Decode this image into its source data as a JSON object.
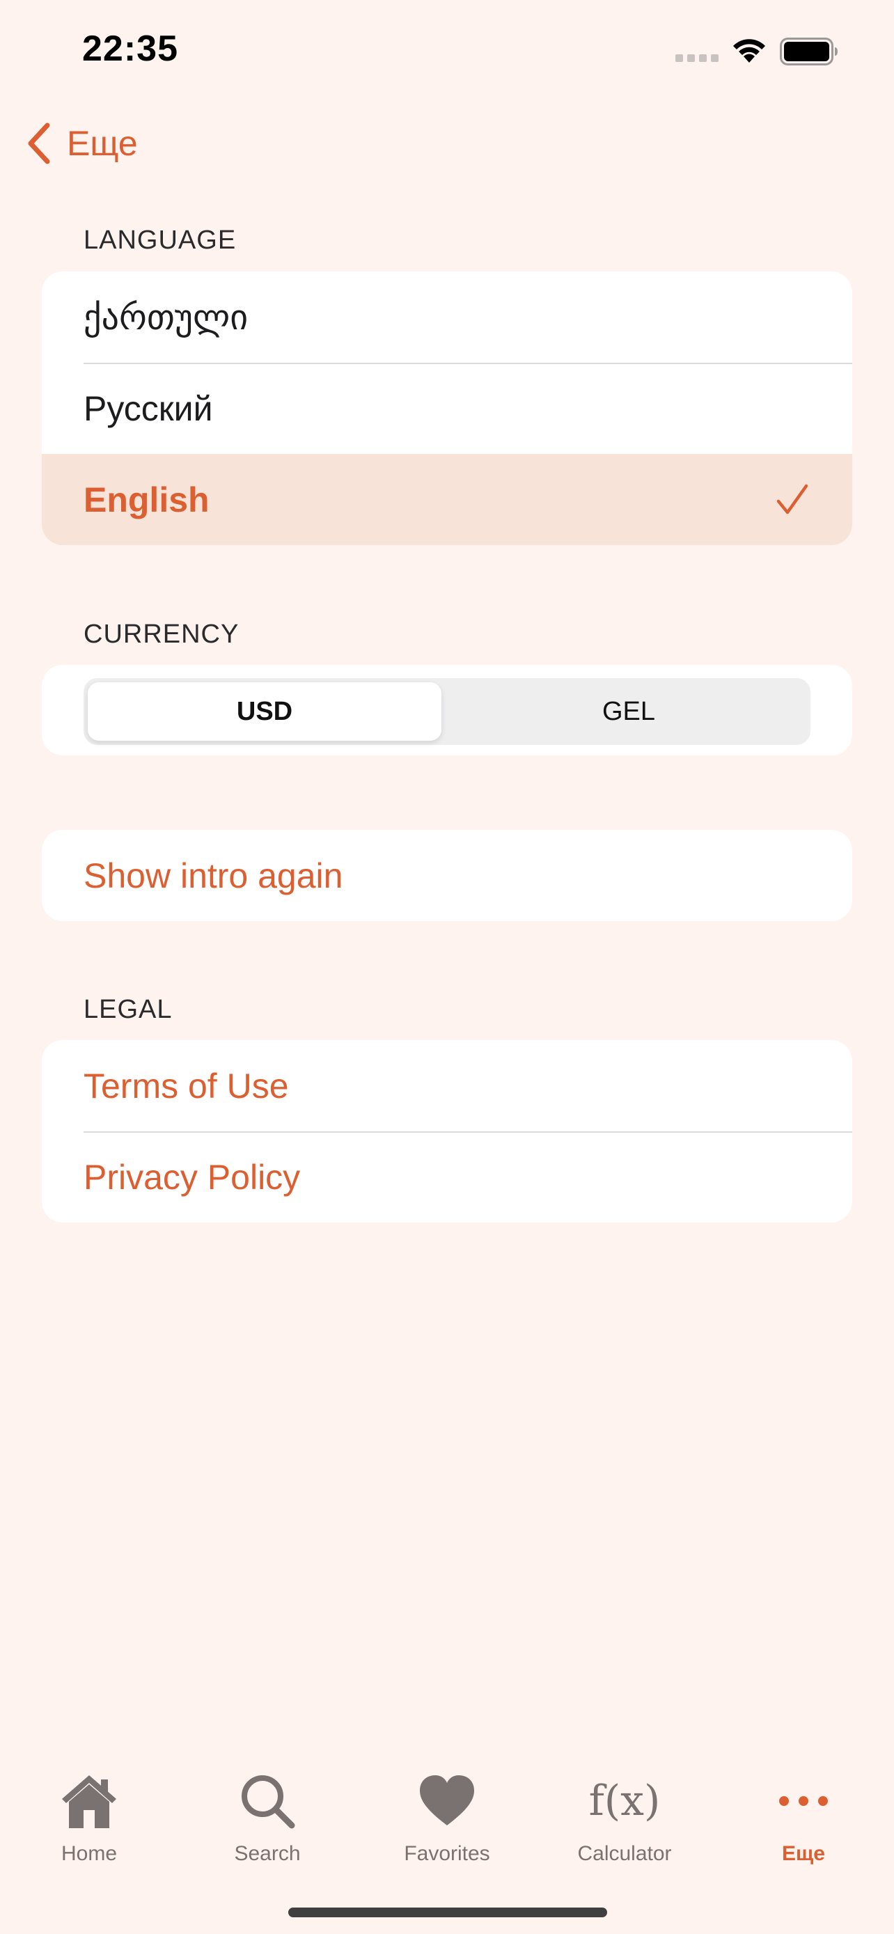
{
  "status_bar": {
    "time": "22:35"
  },
  "nav": {
    "back_label": "Еще"
  },
  "language": {
    "header": "LANGUAGE",
    "options": [
      {
        "label": "ქართული",
        "selected": false
      },
      {
        "label": "Русский",
        "selected": false
      },
      {
        "label": "English",
        "selected": true
      }
    ]
  },
  "currency": {
    "header": "CURRENCY",
    "options": [
      "USD",
      "GEL"
    ],
    "selected": "USD"
  },
  "intro": {
    "label": "Show intro again"
  },
  "legal": {
    "header": "LEGAL",
    "items": [
      "Terms of Use",
      "Privacy Policy"
    ]
  },
  "tabbar": {
    "tabs": [
      {
        "label": "Home",
        "icon": "house-icon",
        "active": false
      },
      {
        "label": "Search",
        "icon": "magnifier-icon",
        "active": false
      },
      {
        "label": "Favorites",
        "icon": "heart-icon",
        "active": false
      },
      {
        "label": "Calculator",
        "icon": "f(x)",
        "active": false
      },
      {
        "label": "Еще",
        "icon": "more-dots-icon",
        "active": true
      }
    ]
  },
  "colors": {
    "accent": "#DC5F31",
    "background": "#FEF3EE",
    "selected_row": "#F8E3D8",
    "tab_inactive": "#7A7270"
  }
}
